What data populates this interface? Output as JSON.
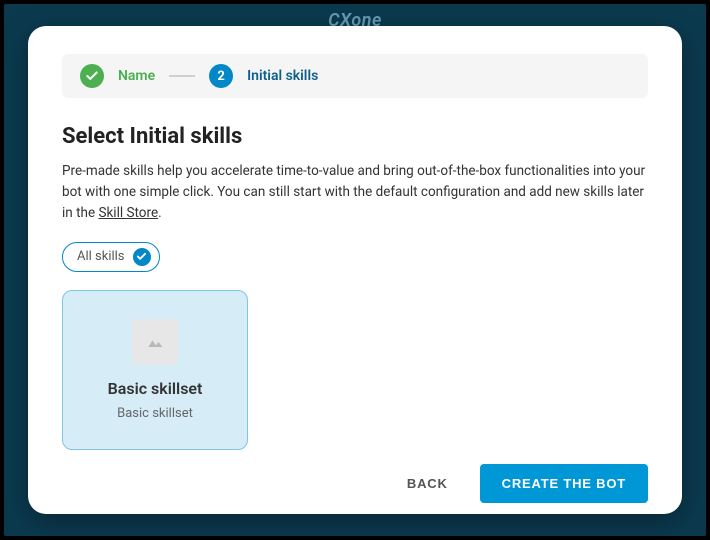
{
  "background": {
    "logo_text": "CXone"
  },
  "stepper": {
    "step1_label": "Name",
    "step2_number": "2",
    "step2_label": "Initial skills"
  },
  "heading": "Select Initial skills",
  "description_part1": "Pre-made skills help you accelerate time-to-value and bring out-of-the-box functionalities into your bot with one simple click. You can still start with the default configuration and add new skills later in the ",
  "description_link": "Skill Store",
  "description_part2": ".",
  "filters": {
    "all_skills": "All skills"
  },
  "cards": [
    {
      "title": "Basic skillset",
      "subtitle": "Basic skillset"
    }
  ],
  "footer": {
    "back": "BACK",
    "create": "CREATE THE BOT"
  }
}
